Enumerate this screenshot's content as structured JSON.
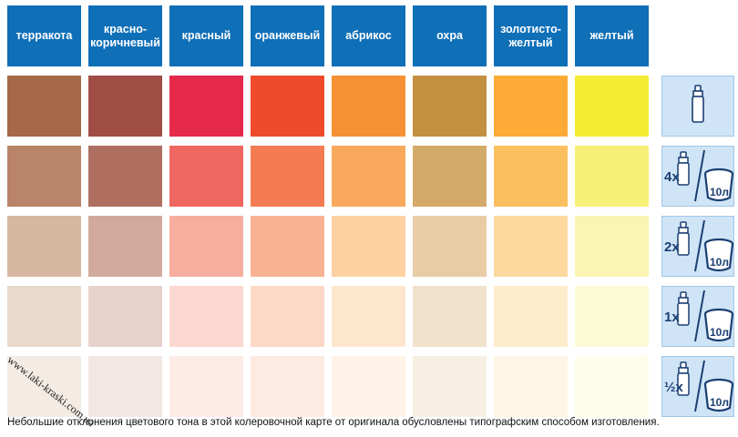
{
  "headers": [
    "терракота",
    "красно-\nкоричневый",
    "красный",
    "оранжевый",
    "абрикос",
    "охра",
    "золотисто-\nжелтый",
    "желтый"
  ],
  "rows": [
    {
      "colors": [
        "#a56848",
        "#a04d46",
        "#e5294b",
        "#ee4b2c",
        "#f59134",
        "#c38f40",
        "#fbab36",
        "#f3ec33"
      ],
      "ratio": "",
      "pail": ""
    },
    {
      "colors": [
        "#b98468",
        "#ae6f60",
        "#ef6761",
        "#f37c52",
        "#f8a95d",
        "#d3aa69",
        "#fcbf60",
        "#f7f078"
      ],
      "ratio": "4x",
      "pail": "10л"
    },
    {
      "colors": [
        "#d6b7a1",
        "#d1aa9d",
        "#f7ae9e",
        "#f9b292",
        "#fdd1a2",
        "#e8cca6",
        "#fdd9a0",
        "#faf5b2"
      ],
      "ratio": "2x",
      "pail": "10л"
    },
    {
      "colors": [
        "#e9d9cc",
        "#e6d2ca",
        "#fbd7cf",
        "#fcd9c7",
        "#fee6ce",
        "#f1e2cc",
        "#feeccc",
        "#fcf9d6"
      ],
      "ratio": "1x",
      "pail": "10л"
    },
    {
      "colors": [
        "#f3ebe4",
        "#f3e7e3",
        "#fdebe6",
        "#fdebe1",
        "#fff2e6",
        "#f7efe4",
        "#fff5e6",
        "#fefcea"
      ],
      "ratio": "½x",
      "pail": "10л"
    }
  ],
  "watermark": "www.laki-kraski.com.ua",
  "footnote": "Небольшие отклонения цветового тона в этой колеровочной карте от оригинала обусловлены типографским способом изготовления."
}
